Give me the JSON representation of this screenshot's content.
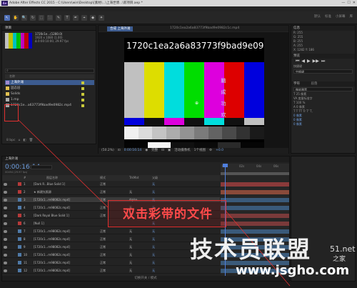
{
  "window": {
    "title": "Adobe After Effects CC 2015 - C:\\Users\\win\\Desktop\\[素材\\...\\上海世博...\\新项目.aep *",
    "app_icon": "Ae",
    "controls": [
      "—",
      "☐",
      "✕"
    ]
  },
  "toolbar": {
    "tools": [
      "↖",
      "✋",
      "🔍",
      "↻",
      "⬚",
      "⬛",
      "✎",
      "T",
      "✒",
      "⌖",
      "◆",
      "✦"
    ],
    "workspaces": [
      "默认",
      "标准",
      "小屏幕",
      "库"
    ]
  },
  "project": {
    "tab": "项目",
    "thumb_info": [
      "1920 x 1080 (1.00)",
      "Δ 0:00:10:00, 29.97 fps"
    ],
    "thumb_title": "1720c1e...(1280.0)",
    "list_header": "名称",
    "items": [
      {
        "name": "上海外滩",
        "icon_color": "#a08ad0",
        "swatch": "#c9c93a",
        "selected": true
      },
      {
        "name": "固态层",
        "icon_color": "#e0c050",
        "swatch": "#c9c93a",
        "selected": false
      },
      {
        "name": "Solids",
        "icon_color": "#e0c050",
        "swatch": "#c9c93a",
        "selected": false
      },
      {
        "name": "1.mp",
        "icon_color": "#aaa",
        "swatch": "#c9c93a",
        "selected": false
      },
      {
        "name": "1720c1e...a63773f9bad9e0982c.mp4",
        "icon_color": "#aaa",
        "swatch": "#c9c93a",
        "selected": false
      }
    ],
    "footer_items": [
      "8 bpc",
      "⌂",
      "◧",
      "🗑"
    ]
  },
  "viewer": {
    "tab_active": "合成 上海外滩",
    "tab_name": "1720c1ea2a6a83773f9bad9e0982c1c.mp4",
    "frame_text": "1720c1ea2a6a83773f9bad9e098",
    "vertical_chars": "脑成功欢",
    "anchor_symbol": "⊕",
    "footer": [
      "(50.2%)",
      "⊡",
      "0:00:16:14",
      "◉",
      "完整",
      "⊡",
      "▣",
      "活动摄像机",
      "1个视图",
      "⚙",
      "+0.0"
    ]
  },
  "right_panel": {
    "info_head": "信息",
    "info_lines": [
      "R: 255",
      "G: 255",
      "B: 255",
      "A: 255",
      "X: 1282   Y: 186"
    ],
    "preview_head": "预览",
    "preview_buttons": [
      "⏮",
      "◀",
      "▶",
      "▶▶",
      "⏭"
    ],
    "shortcut_label": "快捷键",
    "shortcut_value": "空格键",
    "char_head": "字符",
    "font_value": "微软雅黑",
    "para_head": "段落",
    "char_lines": [
      "T  25 像素",
      "VA  度量标准字",
      "T  100 %",
      "A  0 像素",
      "T  T  TT  Tr  T'  T,"
    ],
    "para_values": [
      "0 像素",
      "0 像素",
      "0 像素"
    ]
  },
  "timeline": {
    "tab": "上海外滩",
    "time": "0:00:16:14",
    "frames": "00494 (29.97 fps)",
    "columns": {
      "num": "#",
      "source": "图层名称",
      "mode": "模式",
      "trkmat": "TrkMat",
      "parent": "父级"
    },
    "ruler": [
      "0s",
      "02s",
      "04s",
      "06s"
    ],
    "layers": [
      {
        "num": "1",
        "name": "[Dark R...Blue Solid 1]",
        "mode": "正常",
        "trk": "",
        "parent": "无",
        "color": "#b73a3a",
        "bar": "#8a3a3a"
      },
      {
        "num": "2",
        "name": "★ 新建光照源",
        "mode": "正常",
        "trk": "无",
        "parent": "无",
        "color": "#b73a3a",
        "bar": "#8a4a3a"
      },
      {
        "num": "3",
        "name": "[1720c1...m98082c.mp4]",
        "mode": "正常",
        "trk": "Alpha",
        "parent": "无",
        "color": "#4f7aa8",
        "bar": "#3a5a7a"
      },
      {
        "num": "4",
        "name": "[1720c1...m98082c.mp4]",
        "mode": "正常",
        "trk": "无",
        "parent": "无",
        "color": "#4f7aa8",
        "bar": "#3a5a7a"
      },
      {
        "num": "5",
        "name": "[Dark Royal Blue Solid 1]",
        "mode": "正常",
        "trk": "无",
        "parent": "无",
        "color": "#b73a3a",
        "bar": "#7a3a3a"
      },
      {
        "num": "6",
        "name": "[Null 1]",
        "mode": "",
        "trk": "",
        "parent": "无",
        "color": "#b73a3a",
        "bar": "#7a3a3a"
      },
      {
        "num": "7",
        "name": "[1720c1...m98082c.mp4]",
        "mode": "正常",
        "trk": "无",
        "parent": "无",
        "color": "#4f7aa8",
        "bar": "#3a5a7a"
      },
      {
        "num": "8",
        "name": "[1720c1...m98082c.mp4]",
        "mode": "正常",
        "trk": "无",
        "parent": "无",
        "color": "#4f7aa8",
        "bar": "#3a5a7a"
      },
      {
        "num": "9",
        "name": "[1720c1...m98082c.mp4]",
        "mode": "正常",
        "trk": "无",
        "parent": "无",
        "color": "#4f7aa8",
        "bar": "#3a5a7a"
      },
      {
        "num": "10",
        "name": "[1720c1...m98082c.mp4]",
        "mode": "正常",
        "trk": "无",
        "parent": "无",
        "color": "#4f7aa8",
        "bar": "#3a5a7a"
      },
      {
        "num": "11",
        "name": "[1720c1...m98082c.mp4]",
        "mode": "正常",
        "trk": "无",
        "parent": "无",
        "color": "#4f7aa8",
        "bar": "#3a5a7a"
      },
      {
        "num": "12",
        "name": "[1720c1...m98082c.mp4]",
        "mode": "正常",
        "trk": "无",
        "parent": "无",
        "color": "#4f7aa8",
        "bar": "#3a5a7a"
      }
    ],
    "footer": "切换开关 / 模式"
  },
  "annotation": {
    "text": "双击彩带的文件"
  },
  "watermark": {
    "main": "技术员联盟",
    "url": "www.jsgho.com",
    "corner_a": "51.net",
    "corner_b": "之家"
  },
  "colors": {
    "accent_blue": "#4f7fdd",
    "annotation_red": "#e03030",
    "selection": "#3c5b8f"
  }
}
